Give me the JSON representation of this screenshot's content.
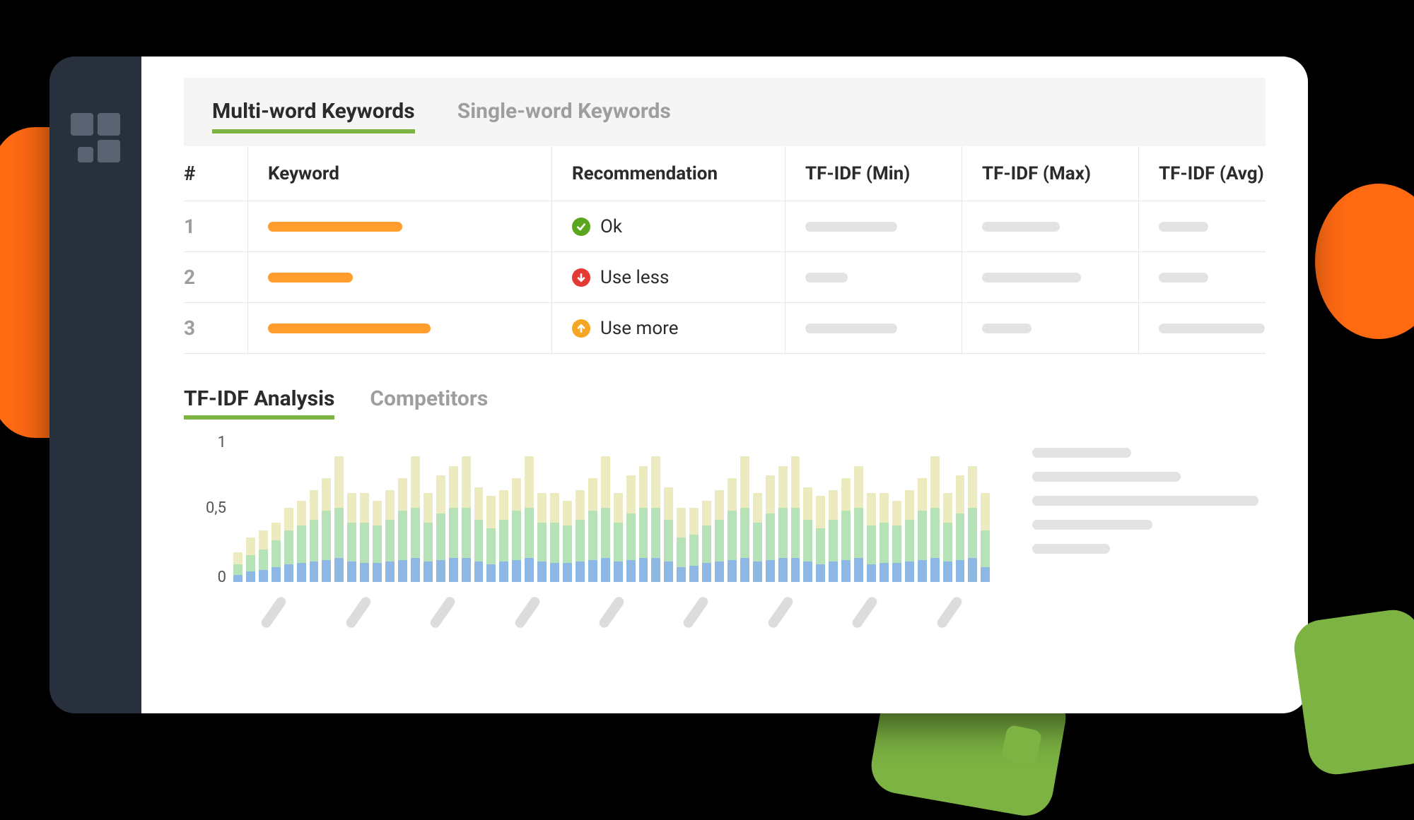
{
  "tabs": {
    "multi": "Multi-word Keywords",
    "single": "Single-word Keywords"
  },
  "table": {
    "headers": {
      "num": "#",
      "keyword": "Keyword",
      "recommendation": "Recommendation",
      "min": "TF-IDF (Min)",
      "max": "TF-IDF (Max)",
      "avg": "TF-IDF (Avg)"
    },
    "rows": [
      {
        "num": "1",
        "keyword_width": 190,
        "rec_kind": "ok",
        "rec_label": "Ok",
        "min_w": 130,
        "max_w": 110,
        "avg_w": 70
      },
      {
        "num": "2",
        "keyword_width": 120,
        "rec_kind": "down",
        "rec_label": "Use less",
        "min_w": 60,
        "max_w": 140,
        "avg_w": 70
      },
      {
        "num": "3",
        "keyword_width": 230,
        "rec_kind": "up",
        "rec_label": "Use more",
        "min_w": 130,
        "max_w": 70,
        "avg_w": 150
      }
    ]
  },
  "analysis_tabs": {
    "tfidf": "TF-IDF Analysis",
    "competitors": "Competitors"
  },
  "chart_data": {
    "type": "bar",
    "title": "TF-IDF Analysis",
    "ylabel": "",
    "xlabel": "",
    "ylim": [
      0,
      1
    ],
    "y_ticks": [
      "1",
      "0,5",
      "0"
    ],
    "series": [
      {
        "name": "bg",
        "color": "#eceabf",
        "values": [
          0.2,
          0.3,
          0.35,
          0.4,
          0.5,
          0.55,
          0.62,
          0.7,
          0.85,
          0.6,
          0.6,
          0.55,
          0.62,
          0.7,
          0.85,
          0.6,
          0.72,
          0.78,
          0.85,
          0.64,
          0.58,
          0.62,
          0.7,
          0.85,
          0.6,
          0.6,
          0.55,
          0.62,
          0.7,
          0.85,
          0.6,
          0.72,
          0.78,
          0.85,
          0.64,
          0.5,
          0.5,
          0.55,
          0.62,
          0.7,
          0.85,
          0.6,
          0.72,
          0.78,
          0.85,
          0.64,
          0.58,
          0.62,
          0.7,
          0.78,
          0.6,
          0.6,
          0.55,
          0.62,
          0.7,
          0.85,
          0.6,
          0.72,
          0.78,
          0.6
        ]
      },
      {
        "name": "mid",
        "color": "#b7e1b6",
        "values": [
          0.12,
          0.18,
          0.22,
          0.28,
          0.35,
          0.38,
          0.42,
          0.48,
          0.5,
          0.4,
          0.4,
          0.38,
          0.42,
          0.48,
          0.5,
          0.4,
          0.46,
          0.5,
          0.5,
          0.42,
          0.36,
          0.42,
          0.48,
          0.5,
          0.4,
          0.4,
          0.38,
          0.42,
          0.48,
          0.5,
          0.4,
          0.46,
          0.5,
          0.5,
          0.42,
          0.3,
          0.32,
          0.38,
          0.42,
          0.48,
          0.5,
          0.4,
          0.46,
          0.5,
          0.5,
          0.42,
          0.36,
          0.42,
          0.48,
          0.5,
          0.38,
          0.4,
          0.38,
          0.42,
          0.48,
          0.5,
          0.4,
          0.46,
          0.5,
          0.35
        ]
      },
      {
        "name": "fg",
        "color": "#8db7e4",
        "values": [
          0.05,
          0.07,
          0.08,
          0.1,
          0.12,
          0.13,
          0.14,
          0.15,
          0.16,
          0.14,
          0.13,
          0.13,
          0.14,
          0.15,
          0.16,
          0.14,
          0.15,
          0.16,
          0.16,
          0.14,
          0.12,
          0.14,
          0.15,
          0.16,
          0.14,
          0.13,
          0.13,
          0.14,
          0.15,
          0.16,
          0.14,
          0.15,
          0.16,
          0.16,
          0.14,
          0.1,
          0.11,
          0.13,
          0.14,
          0.15,
          0.16,
          0.14,
          0.15,
          0.16,
          0.16,
          0.14,
          0.12,
          0.14,
          0.15,
          0.16,
          0.12,
          0.13,
          0.13,
          0.14,
          0.15,
          0.16,
          0.14,
          0.15,
          0.16,
          0.1
        ]
      }
    ],
    "x_tick_groups": 9
  },
  "legend_widths": [
    140,
    210,
    320,
    170,
    110
  ]
}
